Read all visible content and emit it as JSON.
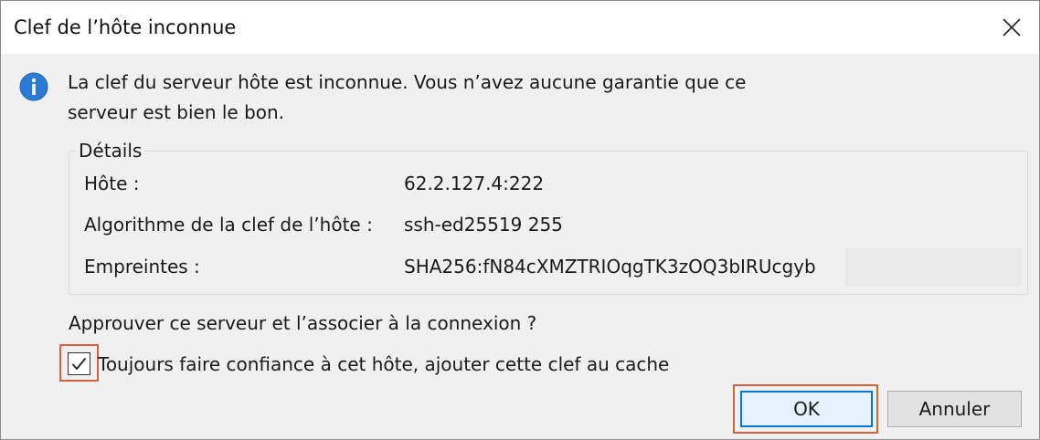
{
  "window": {
    "title": "Clef de l’hôte inconnue",
    "close_symbol": "✕"
  },
  "message": {
    "icon": "info-icon",
    "text": "La clef du serveur hôte est inconnue. Vous n’avez aucune garantie que ce serveur est bien le bon."
  },
  "details": {
    "legend": "Détails",
    "host_label": "Hôte :",
    "host_value": "62.2.127.4:222",
    "algo_label": "Algorithme de la clef de l’hôte :",
    "algo_value": "ssh-ed25519 255",
    "fingerprint_label": "Empreintes :",
    "fingerprint_value": "SHA256:fN84cXMZTRIOqgTK3zOQ3bIRUcgyb"
  },
  "question": "Approuver ce serveur et l’associer à la connexion ?",
  "trust_checkbox": {
    "label": "Toujours faire confiance à cet hôte, ajouter cette clef au cache",
    "checked": true
  },
  "buttons": {
    "ok": "OK",
    "cancel": "Annuler"
  },
  "colors": {
    "accent": "#0078d7",
    "highlight": "#d9603c",
    "info_icon": "#2a7bd4"
  }
}
